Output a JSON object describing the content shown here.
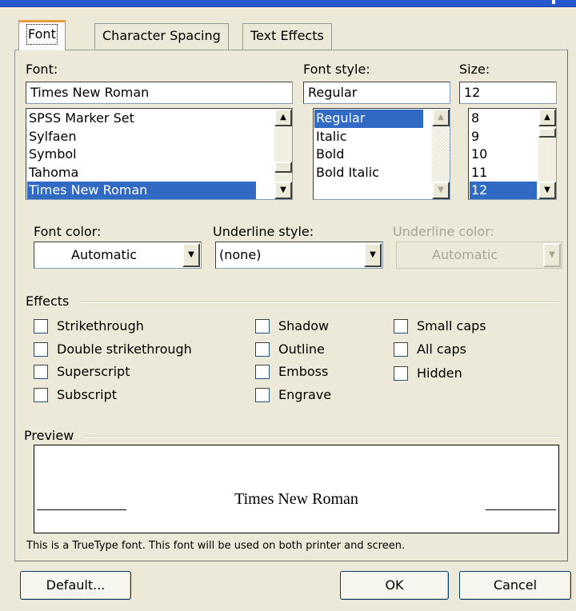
{
  "tabs": [
    {
      "label": "Font",
      "active": true
    },
    {
      "label": "Character Spacing",
      "active": false
    },
    {
      "label": "Text Effects",
      "active": false
    }
  ],
  "font": {
    "label": "Font:",
    "value": "Times New Roman",
    "list": [
      "SPSS Marker Set",
      "Sylfaen",
      "Symbol",
      "Tahoma",
      "Times New Roman"
    ],
    "selected": "Times New Roman"
  },
  "font_style": {
    "label": "Font style:",
    "value": "Regular",
    "list": [
      "Regular",
      "Italic",
      "Bold",
      "Bold Italic"
    ],
    "selected": "Regular"
  },
  "size": {
    "label": "Size:",
    "value": "12",
    "list": [
      "8",
      "9",
      "10",
      "11",
      "12"
    ],
    "selected": "12"
  },
  "font_color": {
    "label": "Font color:",
    "value": "Automatic"
  },
  "underline_style": {
    "label": "Underline style:",
    "value": "(none)"
  },
  "underline_color": {
    "label": "Underline color:",
    "value": "Automatic",
    "disabled": true
  },
  "effects": {
    "label": "Effects",
    "items": [
      {
        "label": "Strikethrough",
        "checked": false
      },
      {
        "label": "Double strikethrough",
        "checked": false
      },
      {
        "label": "Superscript",
        "checked": false
      },
      {
        "label": "Subscript",
        "checked": false
      },
      {
        "label": "Shadow",
        "checked": false
      },
      {
        "label": "Outline",
        "checked": false
      },
      {
        "label": "Emboss",
        "checked": false
      },
      {
        "label": "Engrave",
        "checked": false
      },
      {
        "label": "Small caps",
        "checked": false
      },
      {
        "label": "All caps",
        "checked": false
      },
      {
        "label": "Hidden",
        "checked": false
      }
    ]
  },
  "preview": {
    "label": "Preview",
    "sample": "Times New Roman"
  },
  "footnote": "This is a TrueType font. This font will be used on both printer and screen.",
  "buttons": {
    "default": "Default...",
    "ok": "OK",
    "cancel": "Cancel"
  },
  "icons": {
    "scroll_up": "triangle-up",
    "scroll_down": "triangle-down",
    "dropdown": "triangle-down"
  }
}
